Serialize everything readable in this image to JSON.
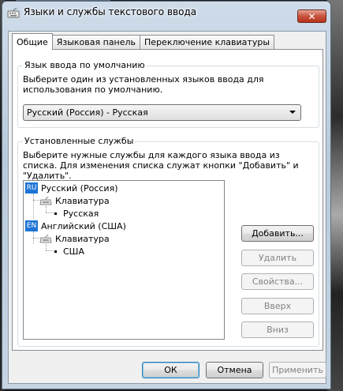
{
  "window": {
    "title": "Языки и службы текстового ввода",
    "close_label": "✕"
  },
  "tabs": [
    {
      "label": "Общие",
      "active": true
    },
    {
      "label": "Языковая панель",
      "active": false
    },
    {
      "label": "Переключение клавиатуры",
      "active": false
    }
  ],
  "default_language": {
    "group_title": "Язык ввода по умолчанию",
    "description": "Выберите один из установленных языков ввода для использования по умолчанию.",
    "selected": "Русский (Россия) - Русская"
  },
  "installed_services": {
    "group_title": "Установленные службы",
    "description": "Выберите нужные службы для каждого языка ввода из списка. Для изменения списка служат кнопки \"Добавить\" и \"Удалить\".",
    "tree": {
      "lang1": {
        "badge": "RU",
        "label": "Русский (Россия)",
        "category": "Клавиатура",
        "item": "Русская"
      },
      "lang2": {
        "badge": "EN",
        "label": "Английский (США)",
        "category": "Клавиатура",
        "item": "США"
      }
    },
    "buttons": {
      "add": "Добавить...",
      "remove": "Удалить",
      "properties": "Свойства...",
      "up": "Вверх",
      "down": "Вниз"
    }
  },
  "footer": {
    "ok": "ОК",
    "cancel": "Отмена",
    "apply": "Применить"
  },
  "colors": {
    "language_badge": "#1e74d5",
    "close_button": "#c7523c"
  }
}
